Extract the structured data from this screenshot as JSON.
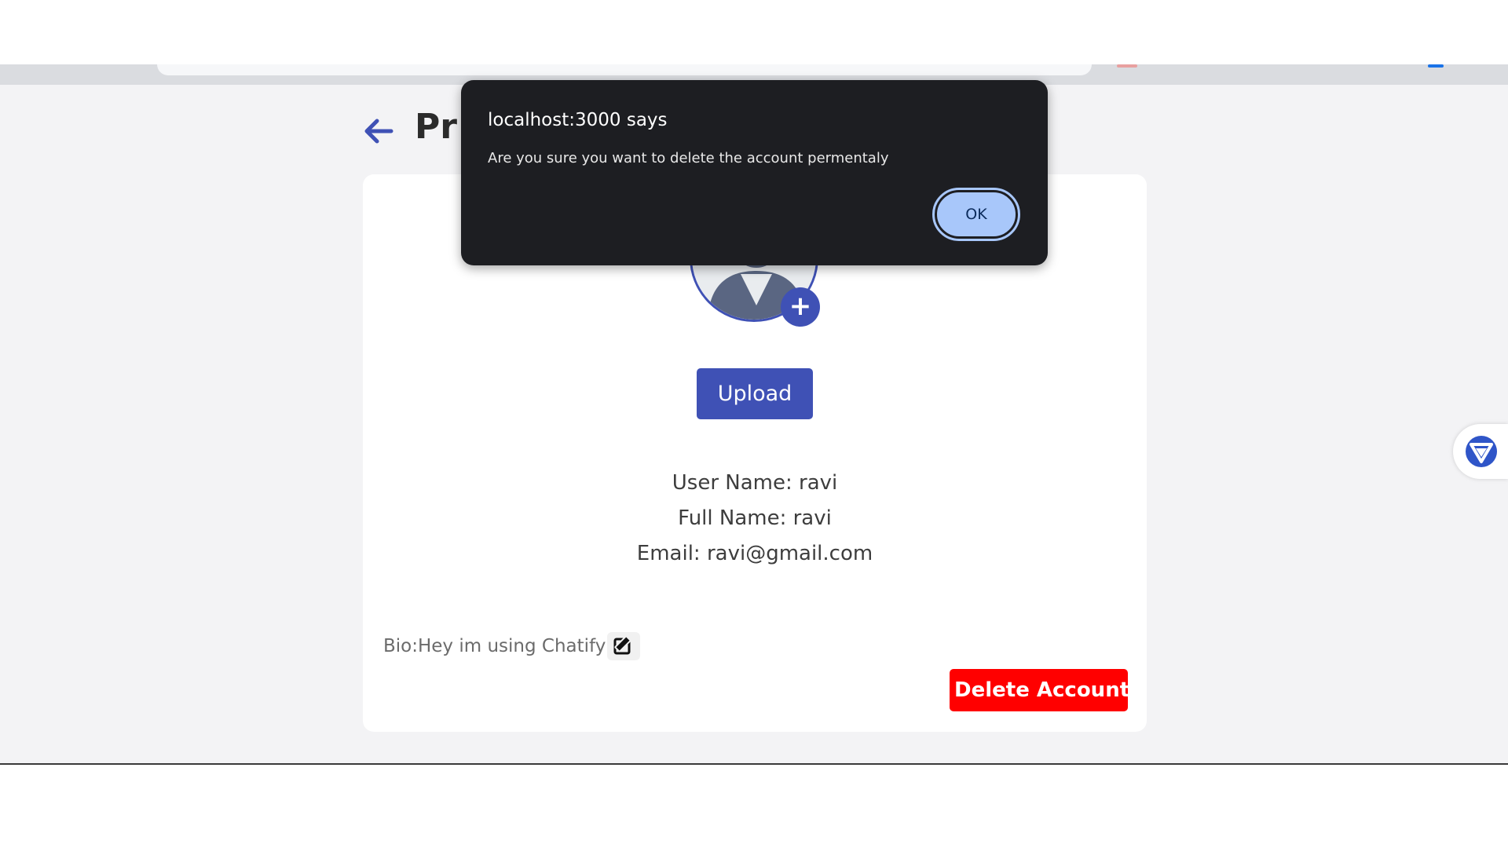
{
  "browser": {
    "accent_color": "#1a73e8"
  },
  "page": {
    "title": "Pr",
    "upload_label": "Upload",
    "user_name": "User Name: ravi",
    "full_name": "Full Name: ravi",
    "email": "Email: ravi@gmail.com",
    "bio": "Bio:Hey im using Chatify",
    "delete_label": "Delete Account",
    "avatar_add_glyph": "+",
    "colors": {
      "primary": "#3f51b5",
      "danger": "#ff0000"
    }
  },
  "dialog": {
    "title": "localhost:3000 says",
    "message": "Are you sure you want to delete the account permentaly",
    "ok_label": "OK"
  },
  "icons": {
    "back": "arrow-left-icon",
    "edit": "edit-icon",
    "extension": "extension-badge-icon"
  }
}
